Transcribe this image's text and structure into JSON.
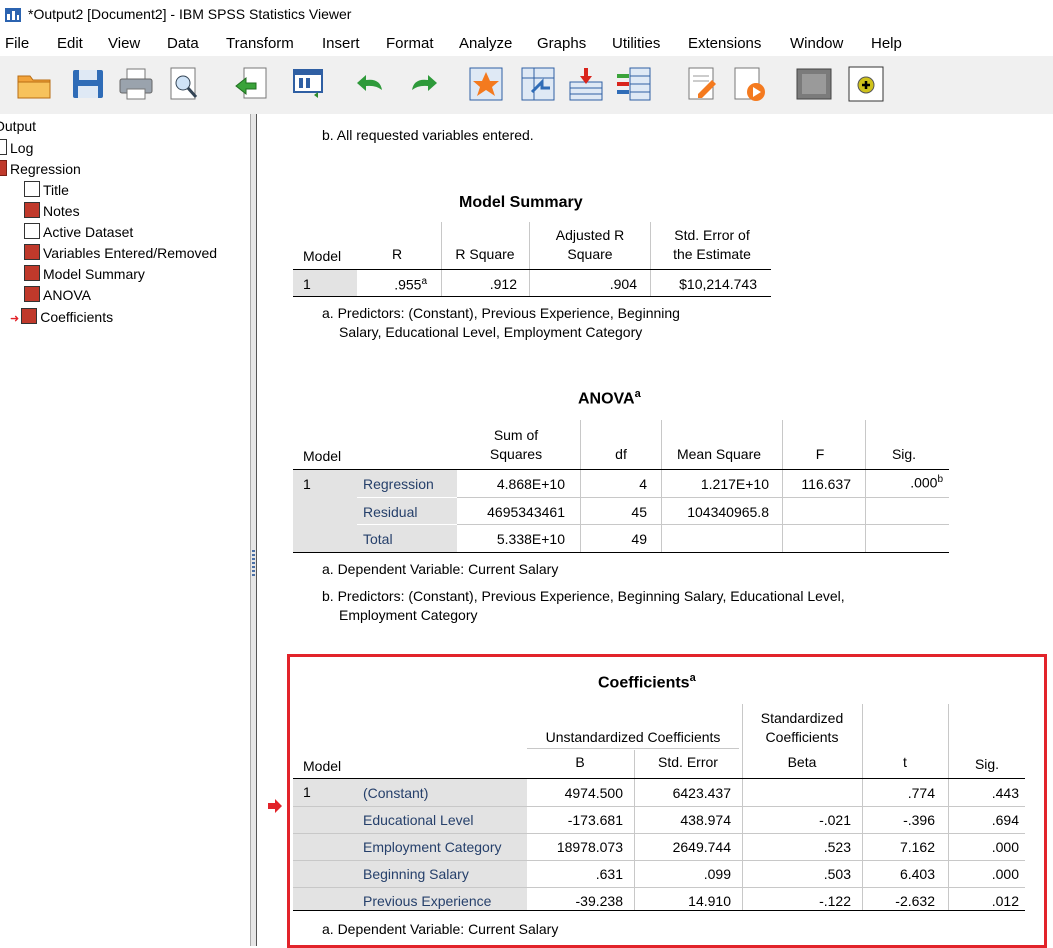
{
  "window": {
    "title": "*Output2 [Document2] - IBM SPSS Statistics Viewer"
  },
  "menu": [
    "File",
    "Edit",
    "View",
    "Data",
    "Transform",
    "Insert",
    "Format",
    "Analyze",
    "Graphs",
    "Utilities",
    "Extensions",
    "Window",
    "Help"
  ],
  "toolbar_icons": [
    "open-icon",
    "save-icon",
    "print-icon",
    "print-preview-icon",
    "export-icon",
    "recall-dialog-icon",
    "undo-icon",
    "redo-icon",
    "goto-case-icon",
    "goto-variable-icon",
    "insert-cases-icon",
    "variables-icon",
    "designate-window-icon",
    "run-icon",
    "collapse-icon",
    "expand-icon"
  ],
  "tree": {
    "root": "Output",
    "items": [
      "Log",
      "Regression",
      "Title",
      "Notes",
      "Active Dataset",
      "Variables Entered/Removed",
      "Model Summary",
      "ANOVA",
      "Coefficients"
    ]
  },
  "output": {
    "variables_footnote_b": "b. All requested variables entered.",
    "model_summary": {
      "title": "Model Summary",
      "headers": [
        "Model",
        "R",
        "R Square",
        "Adjusted R",
        "Square",
        "Std. Error of",
        "the Estimate"
      ],
      "row": {
        "model": "1",
        "r": ".955",
        "r_sup": "a",
        "r_square": ".912",
        "adj_r_square": ".904",
        "std_error": "$10,214.743"
      },
      "footnote_a_line1": "a. Predictors: (Constant), Previous Experience, Beginning",
      "footnote_a_line2": "Salary, Educational Level, Employment Category"
    },
    "anova": {
      "title": "ANOVA",
      "title_sup": "a",
      "headers": {
        "model": "Model",
        "ss1": "Sum of",
        "ss2": "Squares",
        "df": "df",
        "ms": "Mean Square",
        "f": "F",
        "sig": "Sig."
      },
      "model": "1",
      "rows": [
        {
          "label": "Regression",
          "ss": "4.868E+10",
          "df": "4",
          "ms": "1.217E+10",
          "f": "116.637",
          "sig": ".000",
          "sig_sup": "b"
        },
        {
          "label": "Residual",
          "ss": "4695343461",
          "df": "45",
          "ms": "104340965.8",
          "f": "",
          "sig": "",
          "sig_sup": ""
        },
        {
          "label": "Total",
          "ss": "5.338E+10",
          "df": "49",
          "ms": "",
          "f": "",
          "sig": "",
          "sig_sup": ""
        }
      ],
      "footnote_a": "a. Dependent Variable: Current Salary",
      "footnote_b_line1": "b. Predictors: (Constant), Previous Experience, Beginning Salary, Educational Level,",
      "footnote_b_line2": "Employment Category"
    },
    "coefficients": {
      "title": "Coefficients",
      "title_sup": "a",
      "headers": {
        "model": "Model",
        "unstd": "Unstandardized Coefficients",
        "std1": "Standardized",
        "std2": "Coefficients",
        "b": "B",
        "se": "Std. Error",
        "beta": "Beta",
        "t": "t",
        "sig": "Sig."
      },
      "model": "1",
      "rows": [
        {
          "label": "(Constant)",
          "b": "4974.500",
          "se": "6423.437",
          "beta": "",
          "t": ".774",
          "sig": ".443"
        },
        {
          "label": "Educational Level",
          "b": "-173.681",
          "se": "438.974",
          "beta": "-.021",
          "t": "-.396",
          "sig": ".694"
        },
        {
          "label": "Employment Category",
          "b": "18978.073",
          "se": "2649.744",
          "beta": ".523",
          "t": "7.162",
          "sig": ".000"
        },
        {
          "label": "Beginning Salary",
          "b": ".631",
          "se": ".099",
          "beta": ".503",
          "t": "6.403",
          "sig": ".000"
        },
        {
          "label": "Previous Experience",
          "b": "-39.238",
          "se": "14.910",
          "beta": "-.122",
          "t": "-2.632",
          "sig": ".012"
        }
      ],
      "footnote_a": "a. Dependent Variable: Current Salary"
    }
  },
  "colors": {
    "highlight_box": "#e2232a",
    "row_label_bg": "#e3e3e3",
    "label_text": "#26406b"
  }
}
